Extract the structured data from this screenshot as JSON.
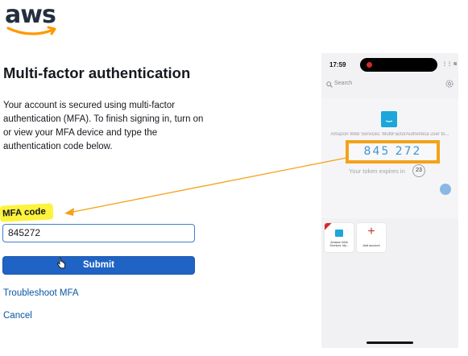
{
  "logo": {
    "text": "aws",
    "colors": {
      "text": "#232f3e",
      "smile": "#ff9900"
    }
  },
  "page": {
    "title": "Multi-factor authentication",
    "description": "Your account is secured using multi-factor authentication (MFA). To finish signing in, turn on or view your MFA device and type the authentication code below."
  },
  "form": {
    "mfa_label": "MFA code",
    "mfa_value": "845272",
    "submit_label": "Submit",
    "troubleshoot_label": "Troubleshoot MFA",
    "cancel_label": "Cancel",
    "colors": {
      "primary": "#1f63c4",
      "link": "#0a55a5",
      "highlight": "#fdf33c"
    }
  },
  "phone": {
    "status_time": "17:59",
    "status_icons": "⋮⋮ ≋ ▭",
    "search_placeholder": "Search",
    "account_name": "Amazon Web Services: MultiFactorAuthentica user to...",
    "token": "845 272",
    "expires_text": "Your token expires in",
    "countdown": "23",
    "tiles": [
      {
        "label": "Amazon Web Services: My...",
        "icon": "aws-icon"
      },
      {
        "label": "Add account",
        "icon": "plus-icon"
      }
    ],
    "colors": {
      "token": "#3e96d3",
      "token_border": "#f4a21a",
      "annotation_arrow": "#f4a21a"
    }
  }
}
